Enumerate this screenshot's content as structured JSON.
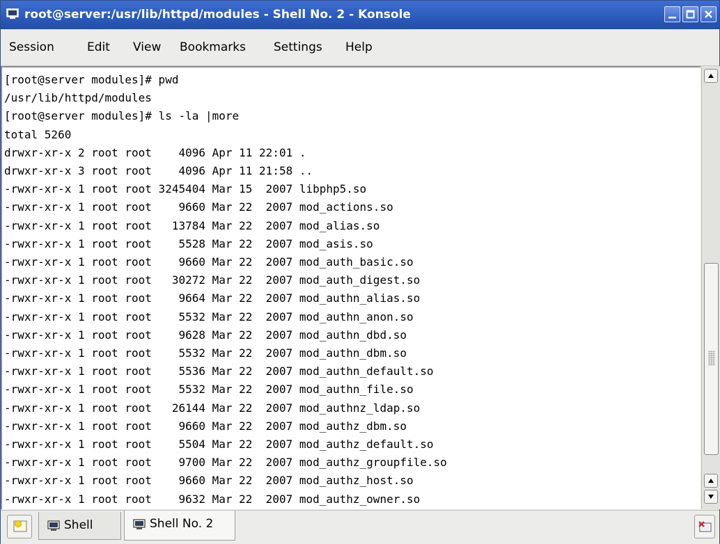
{
  "window": {
    "title": "root@server:/usr/lib/httpd/modules - Shell No. 2 - Konsole",
    "buttons": [
      "minimize",
      "maximize",
      "close"
    ]
  },
  "menubar": {
    "items": [
      "Session",
      "Edit",
      "View",
      "Bookmarks",
      "Settings",
      "Help"
    ]
  },
  "terminal": {
    "lines": [
      "[root@server modules]# pwd",
      "/usr/lib/httpd/modules",
      "[root@server modules]# ls -la |more",
      "total 5260",
      "drwxr-xr-x 2 root root    4096 Apr 11 22:01 .",
      "drwxr-xr-x 3 root root    4096 Apr 11 21:58 ..",
      "-rwxr-xr-x 1 root root 3245404 Mar 15  2007 libphp5.so",
      "-rwxr-xr-x 1 root root    9660 Mar 22  2007 mod_actions.so",
      "-rwxr-xr-x 1 root root   13784 Mar 22  2007 mod_alias.so",
      "-rwxr-xr-x 1 root root    5528 Mar 22  2007 mod_asis.so",
      "-rwxr-xr-x 1 root root    9660 Mar 22  2007 mod_auth_basic.so",
      "-rwxr-xr-x 1 root root   30272 Mar 22  2007 mod_auth_digest.so",
      "-rwxr-xr-x 1 root root    9664 Mar 22  2007 mod_authn_alias.so",
      "-rwxr-xr-x 1 root root    5532 Mar 22  2007 mod_authn_anon.so",
      "-rwxr-xr-x 1 root root    9628 Mar 22  2007 mod_authn_dbd.so",
      "-rwxr-xr-x 1 root root    5532 Mar 22  2007 mod_authn_dbm.so",
      "-rwxr-xr-x 1 root root    5536 Mar 22  2007 mod_authn_default.so",
      "-rwxr-xr-x 1 root root    5532 Mar 22  2007 mod_authn_file.so",
      "-rwxr-xr-x 1 root root   26144 Mar 22  2007 mod_authnz_ldap.so",
      "-rwxr-xr-x 1 root root    9660 Mar 22  2007 mod_authz_dbm.so",
      "-rwxr-xr-x 1 root root    5504 Mar 22  2007 mod_authz_default.so",
      "-rwxr-xr-x 1 root root    9700 Mar 22  2007 mod_authz_groupfile.so",
      "-rwxr-xr-x 1 root root    9660 Mar 22  2007 mod_authz_host.so",
      "-rwxr-xr-x 1 root root    9632 Mar 22  2007 mod_authz_owner.so"
    ]
  },
  "tabs": [
    {
      "label": "Shell",
      "active": false
    },
    {
      "label": "Shell No. 2",
      "active": true
    }
  ],
  "colors": {
    "titlebar": "#2c5bbd",
    "terminal_bg": "#ffffff",
    "terminal_fg": "#000000"
  },
  "icons": {
    "title": "terminal-icon",
    "new_tab": "new-session-icon",
    "tab": "terminal-icon",
    "close_tab": "close-session-icon"
  }
}
